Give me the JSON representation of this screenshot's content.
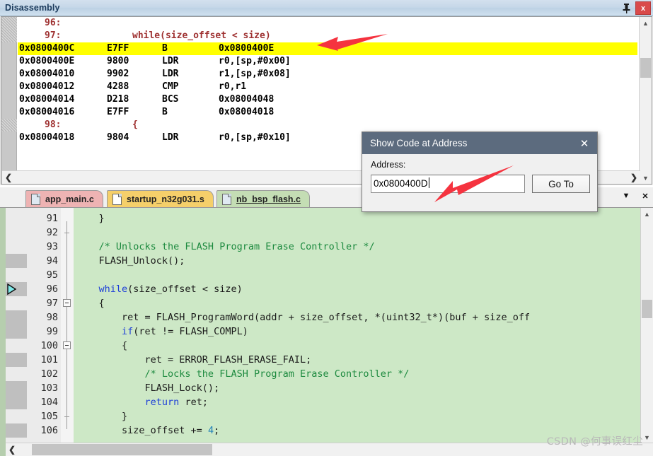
{
  "disassembly_window": {
    "title": "Disassembly",
    "pin_icon": "pin-icon",
    "close_label": "x",
    "lines": [
      {
        "kind": "source",
        "num": "96:",
        "text": ""
      },
      {
        "kind": "source",
        "num": "97:",
        "text": "while(size_offset < size)"
      },
      {
        "kind": "code",
        "highlighted": true,
        "addr": "0x0800400C",
        "opcode": "E7FF",
        "mnemonic": "B",
        "operands": "0x0800400E"
      },
      {
        "kind": "code",
        "highlighted": false,
        "addr": "0x0800400E",
        "opcode": "9800",
        "mnemonic": "LDR",
        "operands": "r0,[sp,#0x00]"
      },
      {
        "kind": "code",
        "highlighted": false,
        "addr": "0x08004010",
        "opcode": "9902",
        "mnemonic": "LDR",
        "operands": "r1,[sp,#0x08]"
      },
      {
        "kind": "code",
        "highlighted": false,
        "addr": "0x08004012",
        "opcode": "4288",
        "mnemonic": "CMP",
        "operands": "r0,r1"
      },
      {
        "kind": "code",
        "highlighted": false,
        "addr": "0x08004014",
        "opcode": "D218",
        "mnemonic": "BCS",
        "operands": "0x08004048"
      },
      {
        "kind": "code",
        "highlighted": false,
        "addr": "0x08004016",
        "opcode": "E7FF",
        "mnemonic": "B",
        "operands": "0x08004018"
      },
      {
        "kind": "source",
        "num": "98:",
        "text": "{"
      },
      {
        "kind": "code",
        "highlighted": false,
        "addr": "0x08004018",
        "opcode": "9804",
        "mnemonic": "LDR",
        "operands": "r0,[sp,#0x10]"
      }
    ],
    "scrollbar": {
      "up_arrow": "chevron-up-icon",
      "down_arrow": "chevron-down-icon",
      "left_arrow": "chevron-left-icon",
      "right_arrow": "chevron-right-icon"
    }
  },
  "editor": {
    "tabs": [
      {
        "label": "app_main.c",
        "active": false
      },
      {
        "label": "startup_n32g031.s",
        "active": false
      },
      {
        "label": "nb_bsp_flash.c",
        "active": true
      }
    ],
    "tabbar_buttons": {
      "dropdown": "▼",
      "close": "✕"
    },
    "code_lines": [
      {
        "number": "91",
        "marker": false,
        "current": false,
        "segments": [
          {
            "t": "    }",
            "c": "plain"
          }
        ]
      },
      {
        "number": "92",
        "marker": false,
        "current": false,
        "segments": [
          {
            "t": "",
            "c": "plain"
          }
        ]
      },
      {
        "number": "93",
        "marker": false,
        "current": false,
        "segments": [
          {
            "t": "    /* Unlocks the FLASH Program Erase Controller */",
            "c": "cmt"
          }
        ]
      },
      {
        "number": "94",
        "marker": true,
        "current": false,
        "segments": [
          {
            "t": "    FLASH_Unlock();",
            "c": "plain"
          }
        ]
      },
      {
        "number": "95",
        "marker": false,
        "current": false,
        "segments": [
          {
            "t": "",
            "c": "plain"
          }
        ]
      },
      {
        "number": "96",
        "marker": true,
        "current": true,
        "segments": [
          {
            "t": "    ",
            "c": "plain"
          },
          {
            "t": "while",
            "c": "kw"
          },
          {
            "t": "(size_offset < size)",
            "c": "plain"
          }
        ]
      },
      {
        "number": "97",
        "marker": false,
        "current": false,
        "segments": [
          {
            "t": "    {",
            "c": "plain"
          }
        ]
      },
      {
        "number": "98",
        "marker": true,
        "current": false,
        "segments": [
          {
            "t": "        ret = FLASH_ProgramWord(addr + size_offset, *(uint32_t*)(buf + size_off",
            "c": "plain"
          }
        ]
      },
      {
        "number": "99",
        "marker": true,
        "current": false,
        "segments": [
          {
            "t": "        ",
            "c": "plain"
          },
          {
            "t": "if",
            "c": "kw"
          },
          {
            "t": "(ret != FLASH_COMPL)",
            "c": "plain"
          }
        ]
      },
      {
        "number": "100",
        "marker": false,
        "current": false,
        "segments": [
          {
            "t": "        {",
            "c": "plain"
          }
        ]
      },
      {
        "number": "101",
        "marker": true,
        "current": false,
        "segments": [
          {
            "t": "            ret = ERROR_FLASH_ERASE_FAIL;",
            "c": "plain"
          }
        ]
      },
      {
        "number": "102",
        "marker": false,
        "current": false,
        "segments": [
          {
            "t": "            /* Locks the FLASH Program Erase Controller */",
            "c": "cmt"
          }
        ]
      },
      {
        "number": "103",
        "marker": true,
        "current": false,
        "segments": [
          {
            "t": "            FLASH_Lock();",
            "c": "plain"
          }
        ]
      },
      {
        "number": "104",
        "marker": true,
        "current": false,
        "segments": [
          {
            "t": "            ",
            "c": "plain"
          },
          {
            "t": "return",
            "c": "kw"
          },
          {
            "t": " ret;",
            "c": "plain"
          }
        ]
      },
      {
        "number": "105",
        "marker": false,
        "current": false,
        "segments": [
          {
            "t": "        }",
            "c": "plain"
          }
        ]
      },
      {
        "number": "106",
        "marker": true,
        "current": false,
        "segments": [
          {
            "t": "        size_offset += ",
            "c": "plain"
          },
          {
            "t": "4",
            "c": "num"
          },
          {
            "t": ";",
            "c": "plain"
          }
        ]
      }
    ],
    "fold_boxes": [
      "97",
      "100"
    ],
    "fold_ticks": [
      "92",
      "105"
    ],
    "current_line_icon": "current-statement-arrow-icon"
  },
  "dialog": {
    "title": "Show Code at Address",
    "close_label": "✕",
    "address_label": "Address:",
    "address_value": "0x0800400D",
    "goto_label": "Go To"
  },
  "annotations": {
    "arrow_disassembly": "red-arrow-pointing-left",
    "arrow_address": "red-arrow-pointing-down-left"
  },
  "watermark": "CSDN @何事误红尘",
  "colors": {
    "highlight_yellow": "#ffff00",
    "editor_background": "#cde8c6",
    "dialog_titlebar": "#5c6b7e",
    "annotation_red": "#f5333f",
    "tab_app_main": "#eeb3b3",
    "tab_startup": "#f5cf6a",
    "tab_flash": "#c4ddb4"
  }
}
